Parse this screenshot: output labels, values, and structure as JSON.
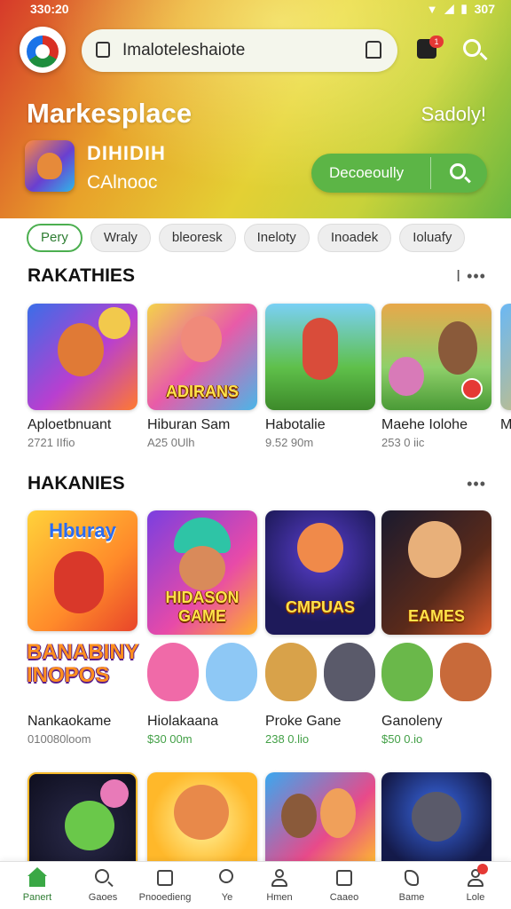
{
  "status_bar": {
    "time": "330:20",
    "right_text": "307"
  },
  "header": {
    "search_text": "Imaloteleshaiote",
    "notification_badge": "1",
    "title": "Markesplace",
    "greeting": "Sadoly!",
    "featured": {
      "name": "DIHIDIH",
      "subtitle": "CAlnooc"
    },
    "discover_label": "Decoeoully"
  },
  "chips": [
    "Pery",
    "Wraly",
    "bleoresk",
    "Ineloty",
    "Inoadek",
    "Ioluafy"
  ],
  "sections": [
    {
      "title": "RAKATHIES",
      "more": "I •••",
      "cards": [
        {
          "name": "Aploetbnuant",
          "sub": "2721 IIfio",
          "sub_color": "gray",
          "art_text": ""
        },
        {
          "name": "Hiburan Sam",
          "sub": "A25 0Ulh",
          "sub_color": "gray",
          "art_text": "ADIRANS"
        },
        {
          "name": "Habotalie",
          "sub": "9.52 90m",
          "sub_color": "gray",
          "art_text": ""
        },
        {
          "name": "Maehe Iolohe",
          "sub": "253 0 iic",
          "sub_color": "gray",
          "art_text": ""
        },
        {
          "name": "M",
          "sub": "",
          "sub_color": "gray",
          "art_text": ""
        }
      ]
    },
    {
      "title": "HAKANIES",
      "more": "•••",
      "cards": [
        {
          "name": "Nankaokame",
          "sub": "010080loom",
          "sub_color": "gray",
          "art_text": "Hburay"
        },
        {
          "name": "Hiolakaana",
          "sub": "$30 00m",
          "sub_color": "green",
          "art_text": "HIDASON GAME"
        },
        {
          "name": "Proke Gane",
          "sub": "238 0.lio",
          "sub_color": "green",
          "art_text": "CMPUAS"
        },
        {
          "name": "Ganoleny",
          "sub": "$50 0.io",
          "sub_color": "green",
          "art_text": "EAMES"
        }
      ],
      "banner_text": "BANABINY INOPOS"
    }
  ],
  "bottom_nav": [
    {
      "label": "Panert",
      "icon": "home-icon",
      "active": true
    },
    {
      "label": "Gaoes",
      "icon": "search-icon",
      "active": false
    },
    {
      "label": "Pnooedieng",
      "icon": "grid-icon",
      "active": false
    },
    {
      "label": "Ye",
      "icon": "face-icon",
      "active": false
    },
    {
      "label": "Hmen",
      "icon": "profile-icon",
      "active": false
    },
    {
      "label": "Caaeo",
      "icon": "square-icon",
      "active": false
    },
    {
      "label": "Bame",
      "icon": "tag-icon",
      "active": false
    },
    {
      "label": "Lole",
      "icon": "user-icon",
      "active": false
    }
  ],
  "colors": {
    "accent_green": "#4caf50",
    "price_green": "#43a047",
    "badge_red": "#e53935"
  }
}
